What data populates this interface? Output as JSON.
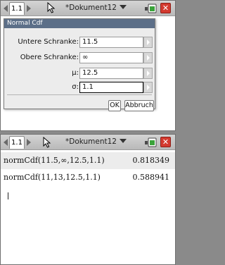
{
  "top": {
    "tab_label": "1.1",
    "doc_title": "*Dokument12",
    "dialog": {
      "title": "Normal Cdf",
      "fields": [
        {
          "label": "Untere Schranke:",
          "value": "11.5"
        },
        {
          "label": "Obere Schranke:",
          "value": "∞"
        },
        {
          "label": "μ:",
          "value": "12.5"
        },
        {
          "label": "σ:",
          "value": "1.1"
        }
      ],
      "ok_label": "OK",
      "cancel_label": "Abbruch"
    }
  },
  "bottom": {
    "tab_label": "1.1",
    "doc_title": "*Dokument12",
    "history": [
      {
        "expression": "normCdf(11.5,∞,12.5,1.1)",
        "result": "0.818349"
      },
      {
        "expression": "normCdf(11,13,12.5,1.1)",
        "result": "0.588941"
      }
    ]
  },
  "colors": {
    "close_button": "#d33a2f",
    "dialog_title_bar": "#5c6f88",
    "selection_row": "#ececec"
  }
}
